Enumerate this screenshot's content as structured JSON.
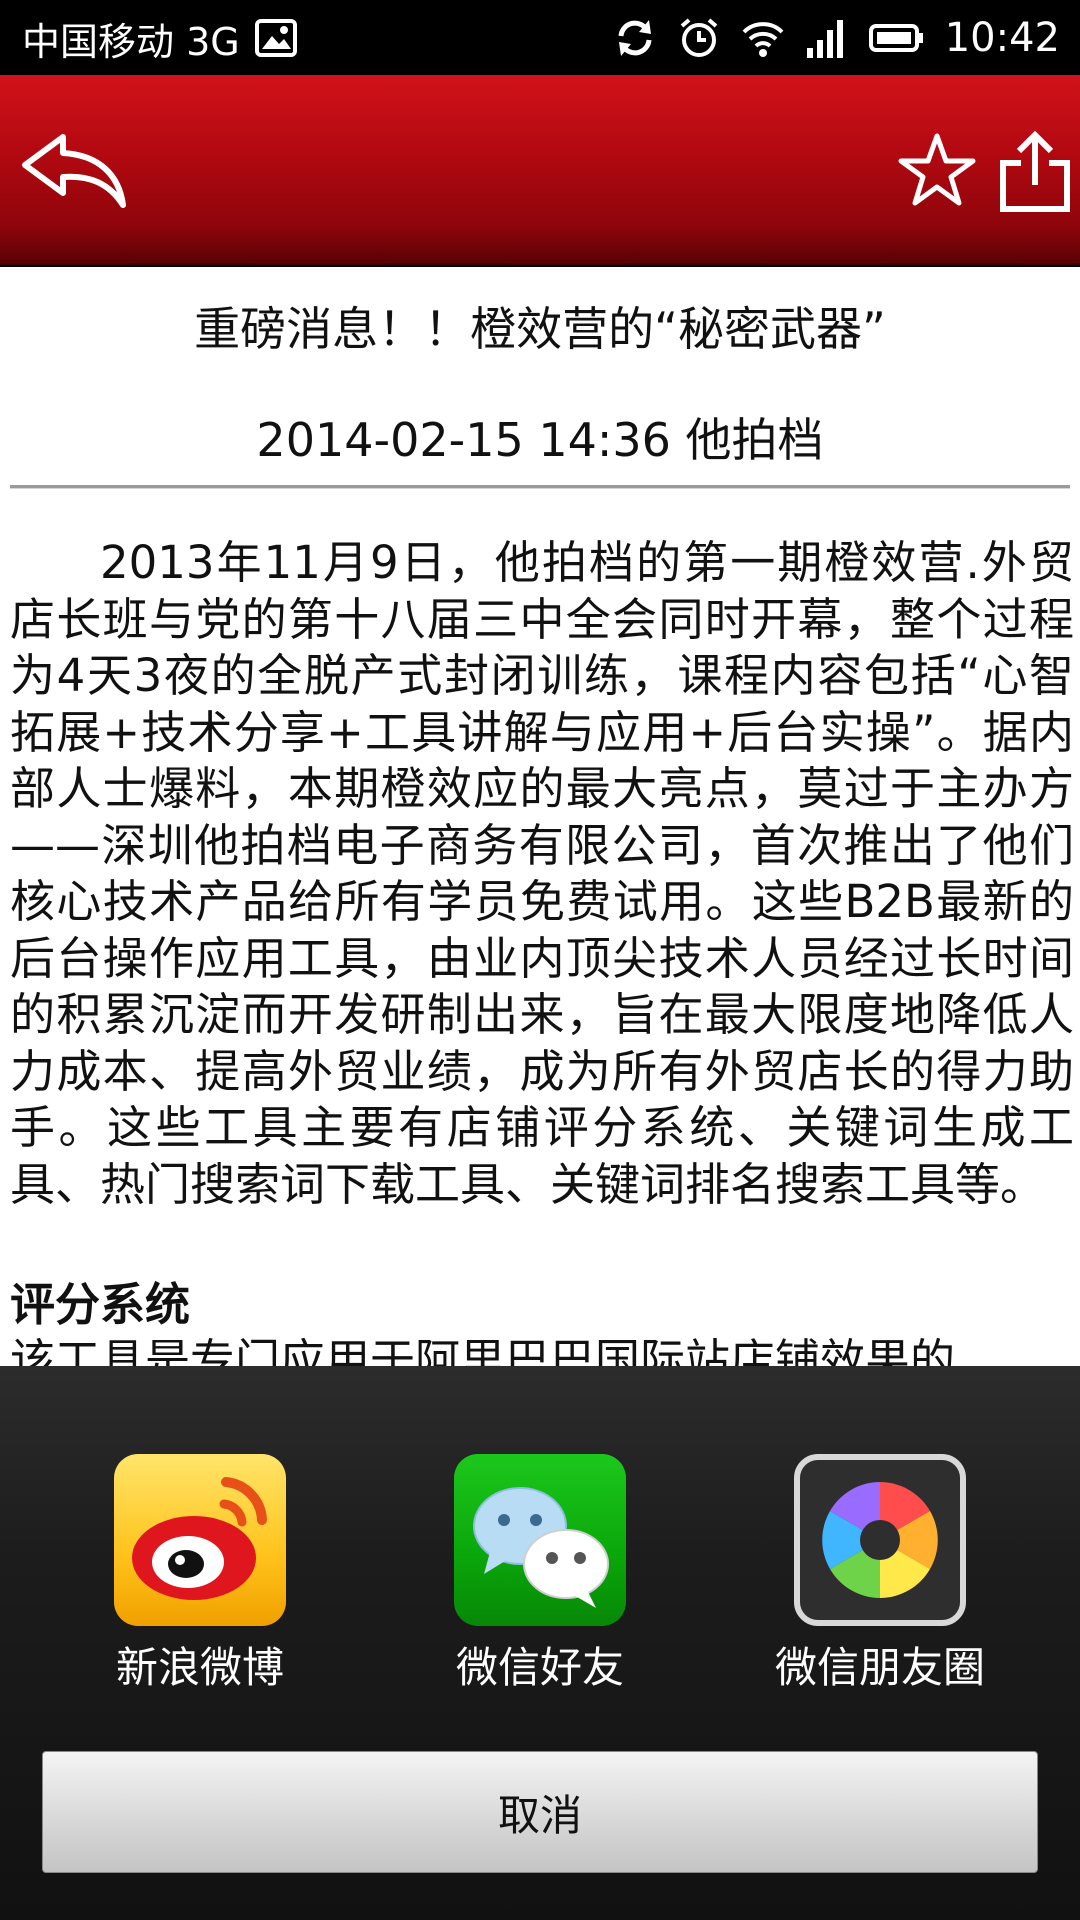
{
  "status_bar": {
    "carrier": "中国移动 3G",
    "time": "10:42",
    "icons": [
      "image-icon",
      "sync-icon",
      "alarm-icon",
      "wifi-icon",
      "signal-icon",
      "battery-icon"
    ]
  },
  "toolbar": {
    "background_color": "#b00810",
    "icons": [
      "back-arrow-icon",
      "star-icon",
      "share-upload-icon"
    ]
  },
  "article": {
    "title": "重磅消息！！橙效营的“秘密武器”",
    "meta": "2014-02-15 14:36 他拍档",
    "body": "2013年11月9日，他拍档的第一期橙效营.外贸店长班与党的第十八届三中全会同时开幕，整个过程为4天3夜的全脱产式封闭训练，课程内容包括“心智拓展+技术分享+工具讲解与应用+后台实操”。据内部人士爆料，本期橙效应的最大亮点，莫过于主办方——深圳他拍档电子商务有限公司，首次推出了他们核心技术产品给所有学员免费试用。这些B2B最新的后台操作应用工具，由业内顶尖技术人员经过长时间的积累沉淀而开发研制出来，旨在最大限度地降低人力成本、提高外贸业绩，成为所有外贸店长的得力助手。这些工具主要有店铺评分系统、关键词生成工具、热门搜索词下载工具、关键词排名搜索工具等。",
    "section_heading": "评分系统",
    "partial_next_line": "该工具是专门应用于阿里巴巴国际站店铺效果的"
  },
  "share_sheet": {
    "items": [
      {
        "label": "新浪微博",
        "icon": "weibo-icon"
      },
      {
        "label": "微信好友",
        "icon": "wechat-icon"
      },
      {
        "label": "微信朋友圈",
        "icon": "moments-icon"
      }
    ],
    "cancel_label": "取消"
  }
}
